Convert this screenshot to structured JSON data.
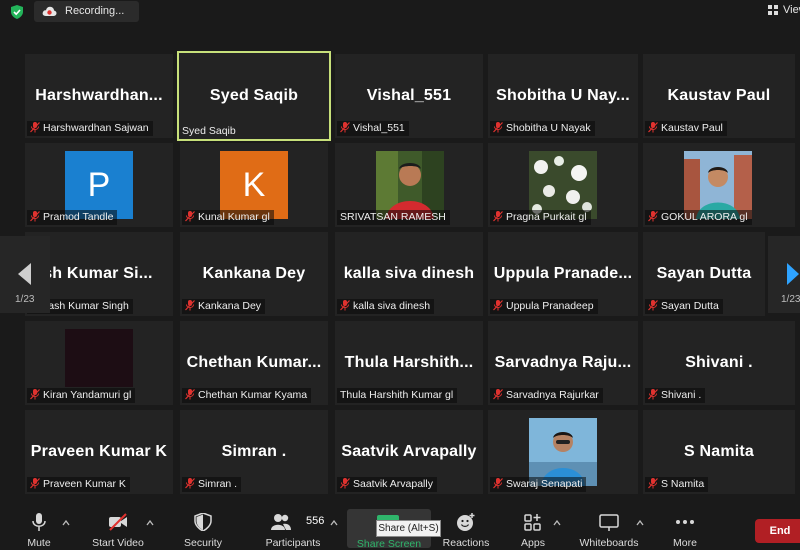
{
  "topbar": {
    "recording_label": "Recording...",
    "view_label": "View"
  },
  "tiles": [
    {
      "big": "Harshwardhan...",
      "label": "Harshwardhan Sajwan",
      "kind": "name"
    },
    {
      "big": "Syed Saqib",
      "label": "Syed Saqib",
      "kind": "name",
      "active": true
    },
    {
      "big": "Vishal_551",
      "label": "Vishal_551",
      "kind": "name"
    },
    {
      "big": "Shobitha U Nay...",
      "label": "Shobitha U Nayak",
      "kind": "name"
    },
    {
      "big": "Kaustav Paul",
      "label": "Kaustav Paul",
      "kind": "name"
    },
    {
      "label": "Pramod Tandle",
      "kind": "avatar",
      "initial": "P",
      "color": "#1a80d0"
    },
    {
      "label": "Kunal Kumar gl",
      "kind": "avatar",
      "initial": "K",
      "color": "#e06c16"
    },
    {
      "label": "SRIVATSAN RAMESH",
      "kind": "photo",
      "photo": "man-red-shirt"
    },
    {
      "label": "Pragna Purkait gl",
      "kind": "photo",
      "photo": "white-flowers"
    },
    {
      "label": "GOKUL ARORA gl",
      "kind": "photo",
      "photo": "man-outdoor"
    },
    {
      "big": "kash  Kumar  Si...",
      "label": "kash Kumar Singh",
      "kind": "name"
    },
    {
      "big": "Kankana Dey",
      "label": "Kankana Dey",
      "kind": "name"
    },
    {
      "big": "kalla siva dinesh",
      "label": "kalla siva dinesh",
      "kind": "name"
    },
    {
      "big": "Uppula  Pranade...",
      "label": "Uppula Pranadeep",
      "kind": "name"
    },
    {
      "big": "Sayan Dutta",
      "label": "Sayan Dutta",
      "kind": "name"
    },
    {
      "label": "Kiran Yandamuri gl",
      "kind": "dark"
    },
    {
      "big": "Chethan  Kumar...",
      "label": "Chethan Kumar Kyama",
      "kind": "name"
    },
    {
      "big": "Thula  Harshith...",
      "label": "Thula Harshith Kumar gl",
      "kind": "name"
    },
    {
      "big": "Sarvadnya  Raju...",
      "label": "Sarvadnya Rajurkar",
      "kind": "name"
    },
    {
      "big": "Shivani .",
      "label": "Shivani .",
      "kind": "name"
    },
    {
      "big": "Praveen Kumar K",
      "label": "Praveen Kumar K",
      "kind": "name"
    },
    {
      "big": "Simran .",
      "label": "Simran .",
      "kind": "name"
    },
    {
      "big": "Saatvik Arvapally",
      "label": "Saatvik Arvapally",
      "kind": "name"
    },
    {
      "label": "Swaraj Senapati",
      "kind": "photo",
      "photo": "man-blue-shirt"
    },
    {
      "big": "S Namita",
      "label": "S Namita",
      "kind": "name"
    }
  ],
  "pagination": {
    "left": "1/23",
    "right": "1/23"
  },
  "toolbar": {
    "mute": "Mute",
    "start_video": "Start Video",
    "security": "Security",
    "participants": "Participants",
    "participants_count": "556",
    "share_screen": "Share Screen",
    "reactions": "Reactions",
    "apps": "Apps",
    "whiteboards": "Whiteboards",
    "more": "More",
    "end": "End"
  },
  "tooltip": "Share (Alt+S)",
  "colors": {
    "active_border": "#c7e07a",
    "share_green": "#2fb56b",
    "end_red": "#b11f24",
    "mic_muted_red": "#e0322f"
  }
}
